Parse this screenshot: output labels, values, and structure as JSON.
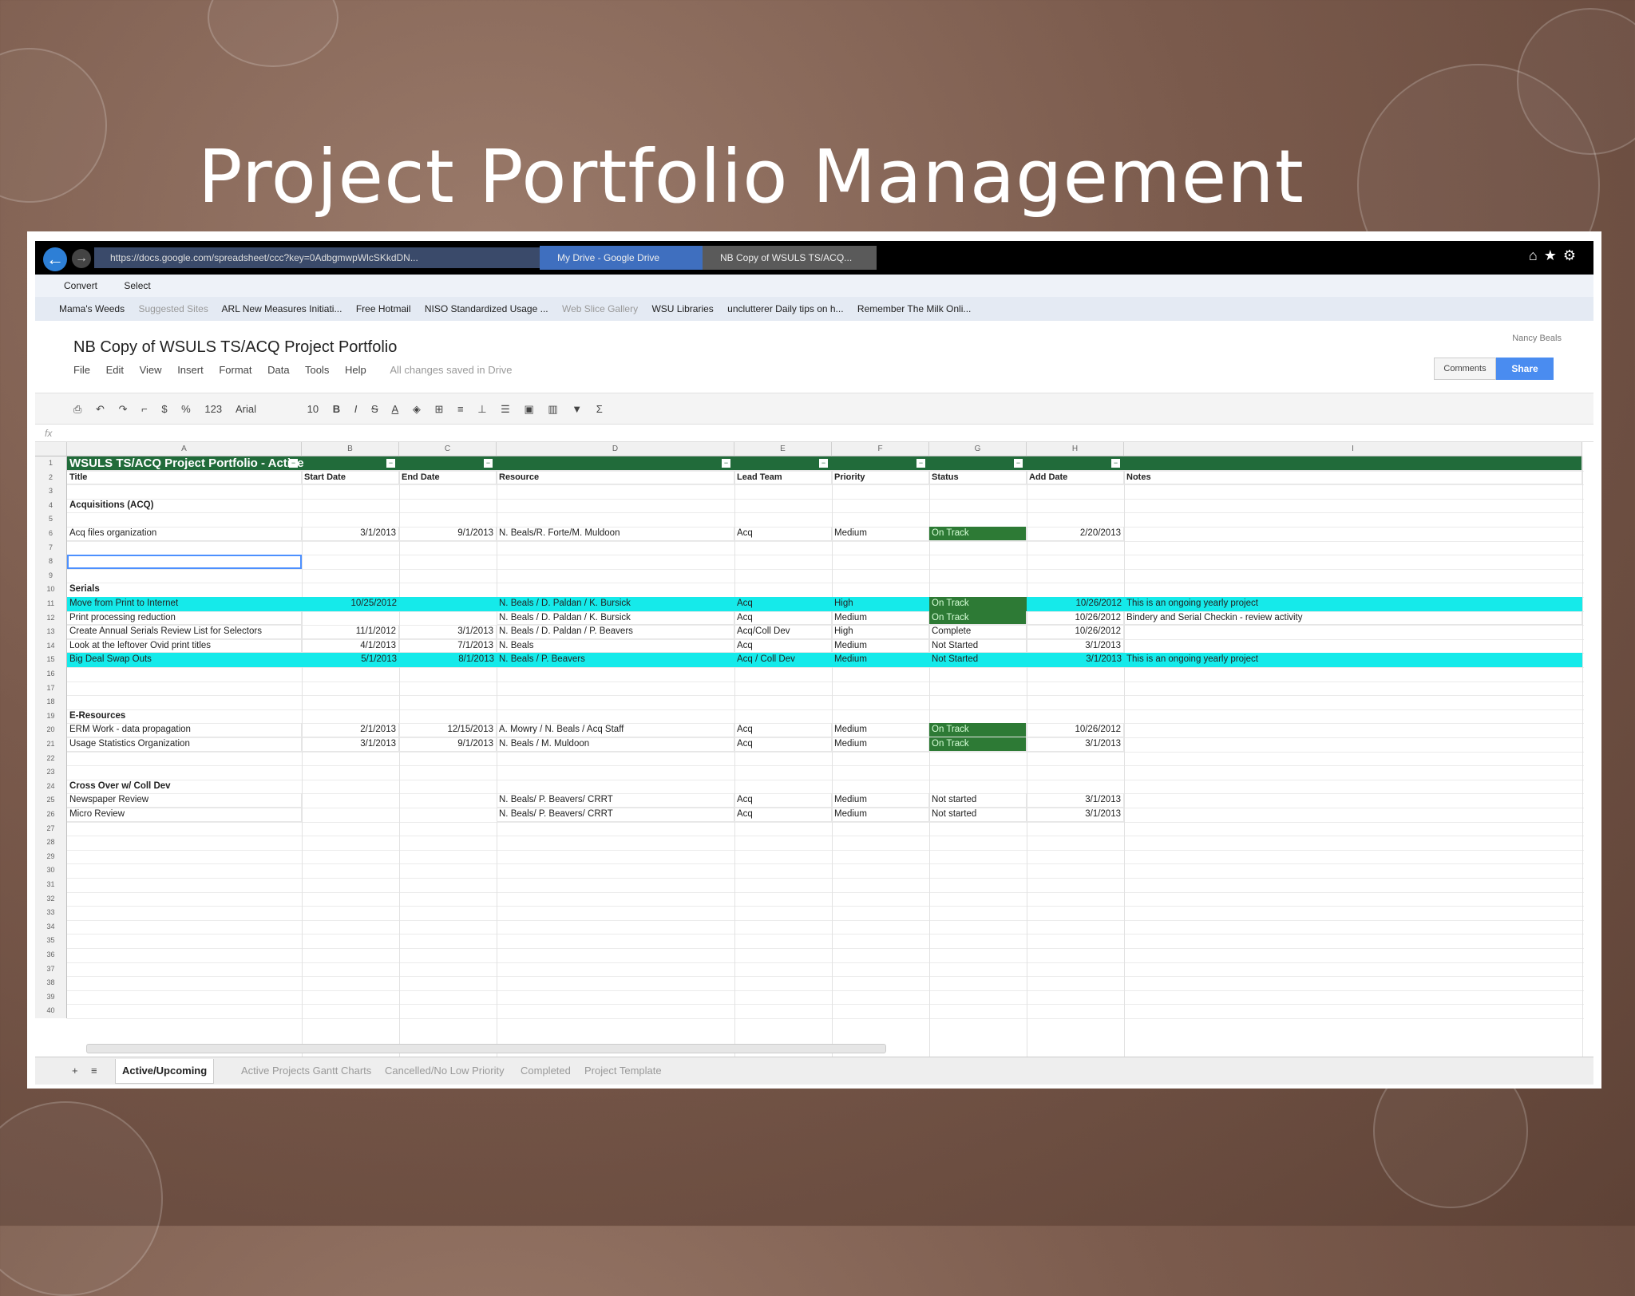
{
  "slide": {
    "title": "Project Portfolio Management"
  },
  "browser": {
    "address": "https://docs.google.com/spreadsheet/ccc?key=0AdbgmwpWlcSKkdDN...",
    "tabs": [
      "My Drive - Google Drive",
      "NB Copy of WSULS TS/ACQ..."
    ],
    "command_items": [
      "Convert",
      "Select"
    ],
    "favorites": [
      "Mama's Weeds",
      "Suggested Sites",
      "ARL New Measures Initiati...",
      "Free Hotmail",
      "NISO Standardized Usage ...",
      "Web Slice Gallery",
      "WSU Libraries",
      "unclutterer Daily tips on h...",
      "Remember The Milk Onli..."
    ]
  },
  "sheets": {
    "doc_title": "NB Copy of WSULS TS/ACQ Project Portfolio",
    "menu": [
      "File",
      "Edit",
      "View",
      "Insert",
      "Format",
      "Data",
      "Tools",
      "Help"
    ],
    "saved_status": "All changes saved in Drive",
    "user": "Nancy Beals",
    "comments_label": "Comments",
    "share_label": "Share",
    "font": "Arial",
    "font_size": "10",
    "number_format": "123",
    "columns": [
      "A",
      "B",
      "C",
      "D",
      "E",
      "F",
      "G",
      "H",
      "I"
    ],
    "grid_title": "WSULS TS/ACQ Project Portfolio - Active",
    "headers": [
      "Title",
      "Start Date",
      "End Date",
      "Resource",
      "Lead Team",
      "Priority",
      "Status",
      "Add Date",
      "Notes"
    ],
    "rows": [
      {
        "n": "4",
        "cells": [
          "Acquisitions (ACQ)",
          "",
          "",
          "",
          "",
          "",
          "",
          "",
          ""
        ],
        "type": "section"
      },
      {
        "n": "6",
        "cells": [
          "Acq files organization",
          "3/1/2013",
          "9/1/2013",
          "N. Beals/R. Forte/M. Muldoon",
          "Acq",
          "Medium",
          "On Track",
          "2/20/2013",
          ""
        ],
        "status_green": true
      },
      {
        "n": "10",
        "cells": [
          "Serials",
          "",
          "",
          "",
          "",
          "",
          "",
          "",
          ""
        ],
        "type": "section"
      },
      {
        "n": "11",
        "cells": [
          "Move from Print to Internet",
          "10/25/2012",
          "",
          "N. Beals / D. Paldan / K. Bursick",
          "Acq",
          "High",
          "On Track",
          "10/26/2012",
          "This is an ongoing yearly project"
        ],
        "cyan": true,
        "status_green": true
      },
      {
        "n": "12",
        "cells": [
          "Print processing reduction",
          "",
          "",
          "N. Beals / D. Paldan / K. Bursick",
          "Acq",
          "Medium",
          "On Track",
          "10/26/2012",
          "Bindery and Serial Checkin - review activity"
        ],
        "status_green": true
      },
      {
        "n": "13",
        "cells": [
          "Create Annual Serials Review List for Selectors",
          "11/1/2012",
          "3/1/2013",
          "N. Beals / D. Paldan / P. Beavers",
          "Acq/Coll Dev",
          "High",
          "Complete",
          "10/26/2012",
          ""
        ]
      },
      {
        "n": "14",
        "cells": [
          "Look at the leftover Ovid print titles",
          "4/1/2013",
          "7/1/2013",
          "N. Beals",
          "Acq",
          "Medium",
          "Not Started",
          "3/1/2013",
          ""
        ]
      },
      {
        "n": "15",
        "cells": [
          "Big Deal Swap Outs",
          "5/1/2013",
          "8/1/2013",
          "N. Beals / P. Beavers",
          "Acq / Coll Dev",
          "Medium",
          "Not Started",
          "3/1/2013",
          "This is an ongoing yearly project"
        ],
        "cyan": true
      },
      {
        "n": "19",
        "cells": [
          "E-Resources",
          "",
          "",
          "",
          "",
          "",
          "",
          "",
          ""
        ],
        "type": "section"
      },
      {
        "n": "20",
        "cells": [
          "ERM Work - data propagation",
          "2/1/2013",
          "12/15/2013",
          "A. Mowry / N. Beals / Acq Staff",
          "Acq",
          "Medium",
          "On Track",
          "10/26/2012",
          ""
        ],
        "status_green": true
      },
      {
        "n": "21",
        "cells": [
          "Usage Statistics Organization",
          "3/1/2013",
          "9/1/2013",
          "N. Beals / M. Muldoon",
          "Acq",
          "Medium",
          "On Track",
          "3/1/2013",
          ""
        ],
        "status_green": true
      },
      {
        "n": "24",
        "cells": [
          "Cross Over w/ Coll Dev",
          "",
          "",
          "",
          "",
          "",
          "",
          "",
          ""
        ],
        "type": "section"
      },
      {
        "n": "25",
        "cells": [
          "Newspaper Review",
          "",
          "",
          "N. Beals/ P. Beavers/ CRRT",
          "Acq",
          "Medium",
          "Not started",
          "3/1/2013",
          ""
        ]
      },
      {
        "n": "26",
        "cells": [
          "Micro Review",
          "",
          "",
          "N. Beals/ P. Beavers/ CRRT",
          "Acq",
          "Medium",
          "Not started",
          "3/1/2013",
          ""
        ]
      }
    ],
    "sheet_tabs": [
      "Active/Upcoming",
      "Active Projects Gantt Charts",
      "Cancelled/No Low Priority",
      "Completed",
      "Project Template"
    ]
  },
  "colors": {
    "title_bar": "#216b3a",
    "on_track": "#2d7a35",
    "highlight_row": "#15eaea",
    "share_button": "#4a8cf0"
  }
}
